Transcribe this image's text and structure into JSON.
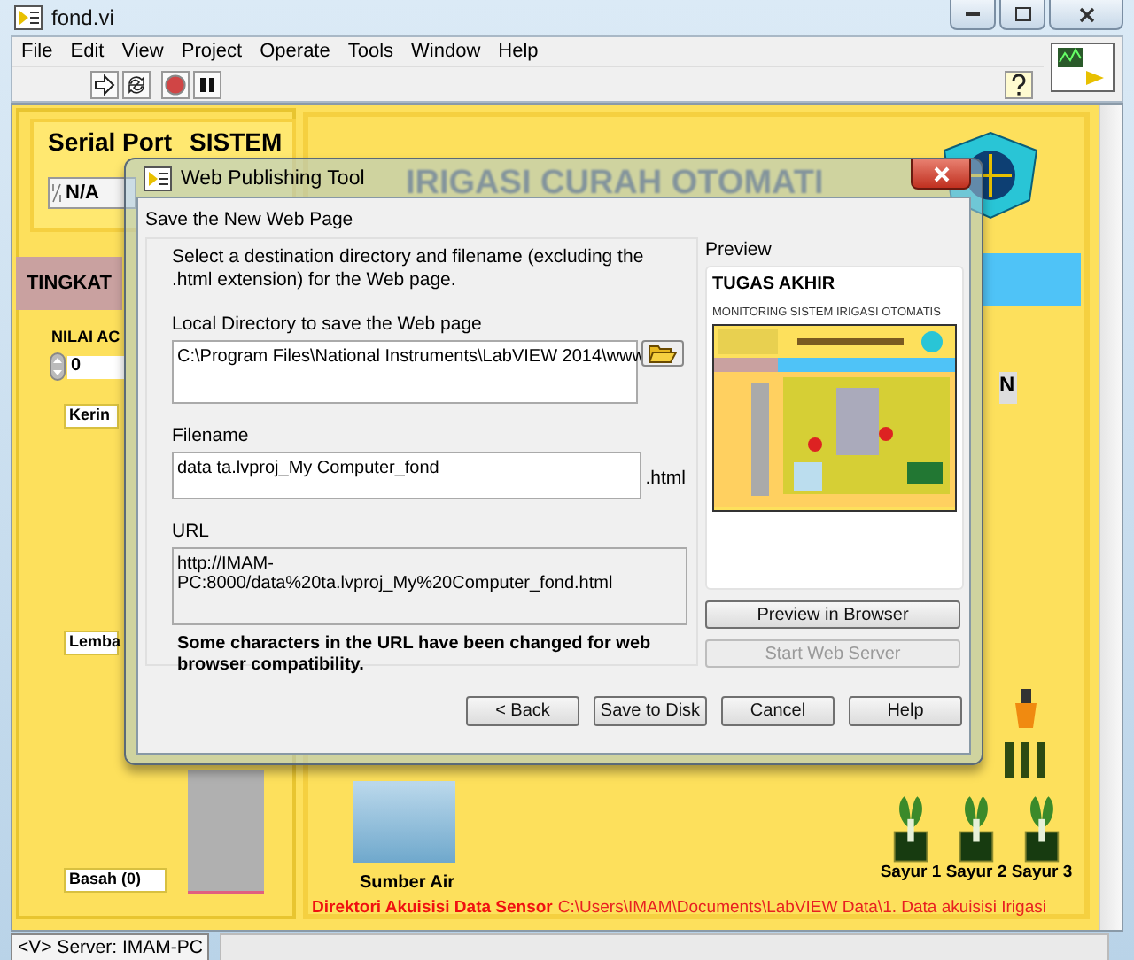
{
  "window": {
    "title": "fond.vi"
  },
  "menu": [
    "File",
    "Edit",
    "View",
    "Project",
    "Operate",
    "Tools",
    "Window",
    "Help"
  ],
  "front_panel": {
    "serial_port": {
      "label": "Serial Port",
      "value": "N/A"
    },
    "system_label": "SISTEM",
    "heading": "IRIGASI CURAH OTOMATI",
    "level_tab": "TINGKAT",
    "setpoint_label": "NILAI AC",
    "setpoint_value": "0",
    "indicators": [
      {
        "label": "Kerin"
      },
      {
        "label": "Lemba"
      },
      {
        "label": "Basah (0)"
      }
    ],
    "cut_label": "N",
    "water_source": "Sumber Air",
    "plants": [
      "Sayur 1",
      "Sayur 2",
      "Sayur 3"
    ],
    "directory_label": "Direktori Akuisisi Data Sensor",
    "directory_path": "C:\\Users\\IMAM\\Documents\\LabVIEW Data\\1. Data akuisisi Irigasi"
  },
  "status_bar": {
    "server": "<V> Server: IMAM-PC"
  },
  "dialog": {
    "title": "Web Publishing Tool",
    "section_title": "Save the New Web Page",
    "instruction": "Select a destination directory and filename (excluding the .html extension) for the Web page.",
    "directory": {
      "label": "Local Directory to save the Web page",
      "value": "C:\\Program Files\\National Instruments\\LabVIEW 2014\\www"
    },
    "filename": {
      "label": "Filename",
      "value": "data ta.lvproj_My Computer_fond",
      "suffix": ".html"
    },
    "url": {
      "label": "URL",
      "value": "http://IMAM-PC:8000/data%20ta.lvproj_My%20Computer_fond.html"
    },
    "note": "Some characters in the URL have been changed for web browser compatibility.",
    "preview": {
      "label": "Preview",
      "title": "TUGAS AKHIR",
      "subtitle": "MONITORING SISTEM IRIGASI OTOMATIS"
    },
    "side_buttons": [
      {
        "label": "Preview in Browser",
        "disabled": false
      },
      {
        "label": "Start Web Server",
        "disabled": true
      }
    ],
    "buttons": [
      {
        "label": "< Back",
        "disabled": false
      },
      {
        "label": "Save to Disk",
        "disabled": false
      },
      {
        "label": "Cancel",
        "disabled": false
      },
      {
        "label": "Help",
        "disabled": false
      }
    ]
  }
}
